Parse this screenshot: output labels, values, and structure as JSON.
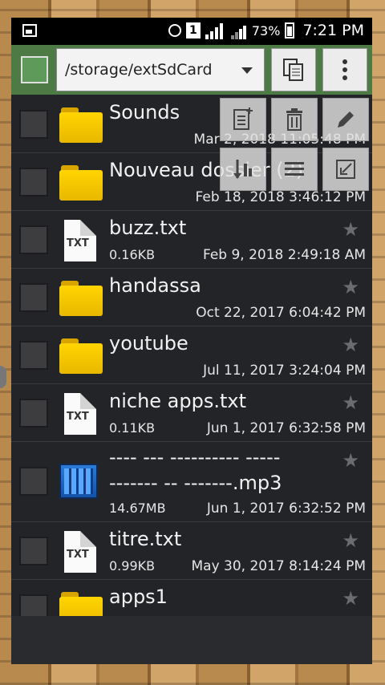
{
  "status_bar": {
    "battery": "73%",
    "time": "7:21 PM",
    "sim": "1"
  },
  "toolbar": {
    "path": "/storage/extSdCard"
  },
  "files": [
    {
      "name": "Sounds",
      "type": "folder",
      "size": "",
      "date": "Mar 2, 2018 11:05:48 PM"
    },
    {
      "name": "Nouveau dossier (2)",
      "type": "folder",
      "size": "",
      "date": "Feb 18, 2018 3:46:12 PM"
    },
    {
      "name": "buzz.txt",
      "type": "txt",
      "size": "0.16KB",
      "date": "Feb 9, 2018 2:49:18 AM"
    },
    {
      "name": "handassa",
      "type": "folder",
      "size": "",
      "date": "Oct 22, 2017 6:04:42 PM"
    },
    {
      "name": "youtube",
      "type": "folder",
      "size": "",
      "date": "Jul 11, 2017 3:24:04 PM"
    },
    {
      "name": "niche apps.txt",
      "type": "txt",
      "size": "0.11KB",
      "date": "Jun 1, 2017 6:32:58 PM"
    },
    {
      "name_line1": "---- --- ---------- -----",
      "name_line2": "------- -- -------.mp3",
      "type": "mp3",
      "size": "14.67MB",
      "date": "Jun 1, 2017 6:32:52 PM"
    },
    {
      "name": "titre.txt",
      "type": "txt",
      "size": "0.99KB",
      "date": "May 30, 2017 8:14:24 PM"
    },
    {
      "name": "apps1",
      "type": "folder",
      "size": "",
      "date": ""
    }
  ],
  "txt_label": "TXT",
  "colors": {
    "toolbar_bg": "#4d7a45",
    "list_bg": "#232427",
    "folder": "#ffd500"
  }
}
